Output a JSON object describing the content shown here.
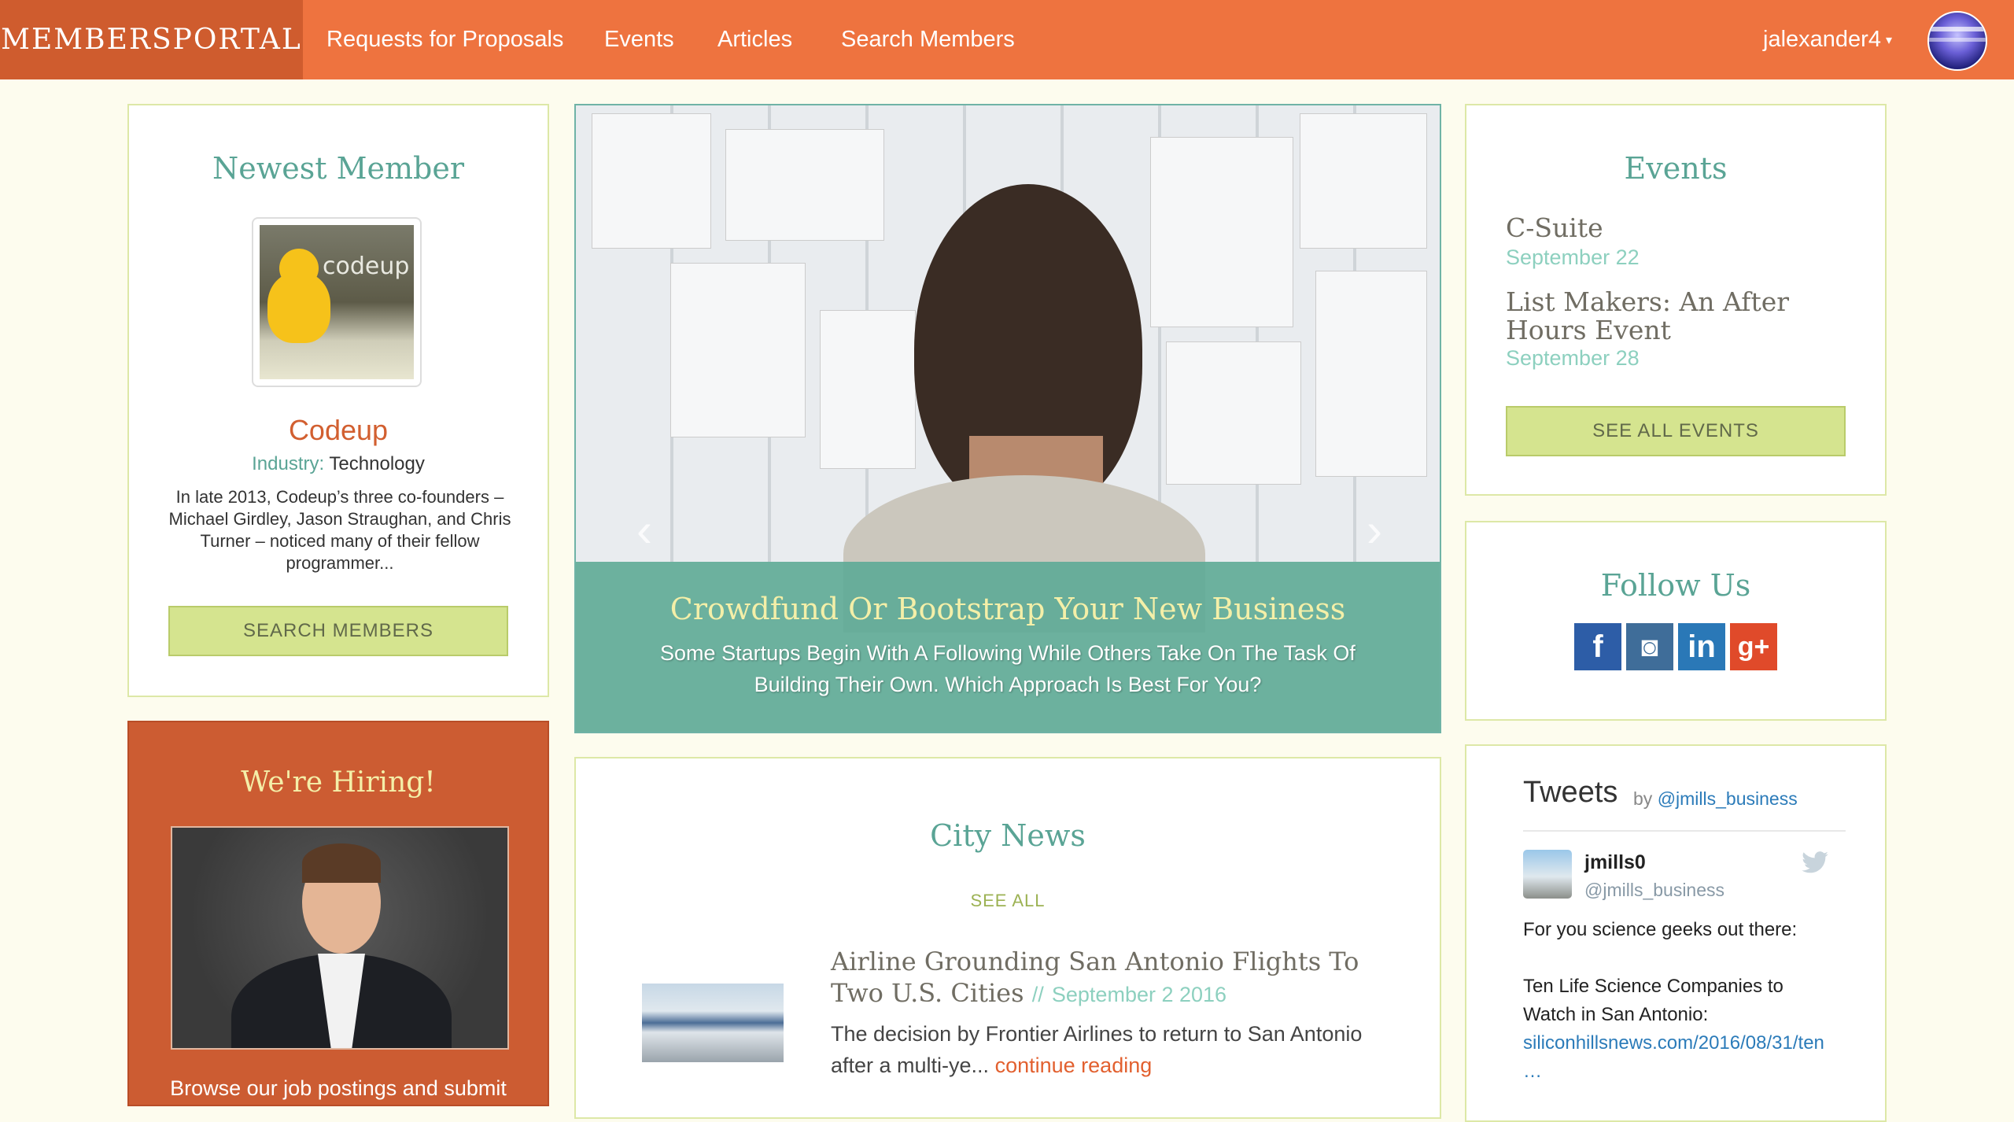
{
  "nav": {
    "brand": "MEMBERSPORTAL",
    "links": [
      "Requests for Proposals",
      "Events",
      "Articles",
      "Search Members"
    ],
    "user": "jalexander4",
    "caret": "▾"
  },
  "newest": {
    "heading": "Newest Member",
    "logo_text": "codeup",
    "name": "Codeup",
    "industry_label": "Industry:",
    "industry_value": "Technology",
    "blurb": "In late 2013, Codeup’s three co-founders – Michael Girdley, Jason Straughan, and Chris Turner – noticed many of their fellow programmer...",
    "button": "SEARCH MEMBERS"
  },
  "hero": {
    "title": "Crowdfund Or Bootstrap Your New Business",
    "subtitle": "Some Startups Begin With A Following While Others Take On The Task Of Building Their Own. Which Approach Is Best For You?",
    "prev": "‹",
    "next": "›"
  },
  "events": {
    "heading": "Events",
    "items": [
      {
        "title": "C-Suite",
        "date": "September 22"
      },
      {
        "title": "List Makers: An After Hours Event",
        "date": "September 28"
      }
    ],
    "button": "SEE ALL EVENTS"
  },
  "follow": {
    "heading": "Follow Us",
    "icons": [
      {
        "glyph": "f",
        "color": "#2d5da7"
      },
      {
        "glyph": "◙",
        "color": "#3f6d99"
      },
      {
        "glyph": "in",
        "color": "#2a78b7"
      },
      {
        "glyph": "g+",
        "color": "#e04a2a"
      }
    ]
  },
  "hiring": {
    "heading": "We're Hiring!",
    "text": "Browse our job postings and submit"
  },
  "news": {
    "heading": "City News",
    "see_all": "SEE ALL",
    "article": {
      "title": "Airline Grounding San Antonio Flights To Two U.S. Cities",
      "sep": "//",
      "date": "September 2 2016",
      "excerpt": "The decision by Frontier Airlines to return to San Antonio after a multi-ye...",
      "more": "continue reading"
    }
  },
  "tweets": {
    "heading": "Tweets",
    "by": "by",
    "account": "@jmills_business",
    "tweet": {
      "name": "jmills0",
      "handle": "@jmills_business",
      "line1": "For you science geeks out there:",
      "line2": "Ten Life Science Companies to",
      "line3": "Watch in San Antonio:",
      "link": "siliconhillsnews.com/2016/08/31/ten",
      "ellipsis": "…"
    }
  }
}
